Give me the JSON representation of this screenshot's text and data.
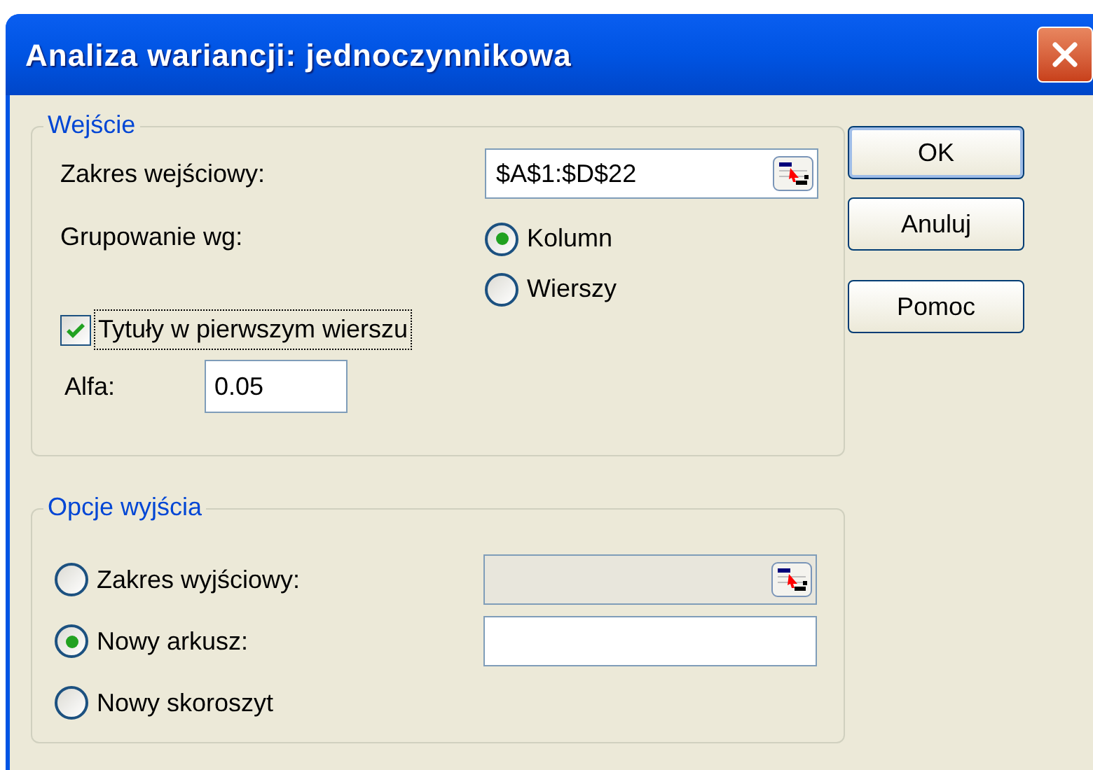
{
  "window": {
    "title": "Analiza wariancji: jednoczynnikowa"
  },
  "input_group": {
    "title": "Wejście",
    "range": {
      "label": "Zakres wejściowy:",
      "value": "$A$1:$D$22"
    },
    "grouping": {
      "label": "Grupowanie wg:",
      "options": [
        {
          "label": "Kolumn",
          "selected": true
        },
        {
          "label": "Wierszy",
          "selected": false
        }
      ]
    },
    "titles_checkbox": {
      "label": "Tytuły w pierwszym wierszu",
      "checked": true,
      "focused": true
    },
    "alpha": {
      "label": "Alfa:",
      "value": "0.05"
    }
  },
  "output_group": {
    "title": "Opcje wyjścia",
    "options": [
      {
        "label": "Zakres wyjściowy:",
        "selected": false,
        "field": {
          "kind": "range",
          "disabled": true
        }
      },
      {
        "label": "Nowy arkusz:",
        "selected": true,
        "field": {
          "kind": "text",
          "disabled": false
        }
      },
      {
        "label": "Nowy skoroszyt",
        "selected": false
      }
    ]
  },
  "buttons": [
    {
      "label": "OK",
      "default": true
    },
    {
      "label": "Anuluj",
      "default": false
    },
    {
      "label": "Pomoc",
      "default": false
    }
  ]
}
